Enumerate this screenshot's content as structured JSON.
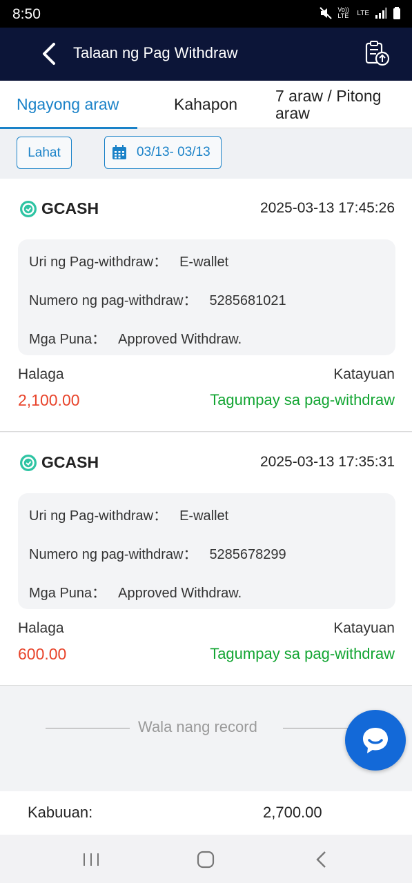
{
  "status_bar": {
    "time": "8:50",
    "icons": [
      "mute-icon",
      "volte-icon",
      "lte-icon",
      "signal-icon",
      "battery-icon"
    ],
    "volte_text": "Vo)) LTE",
    "lte_text": "LTE"
  },
  "header": {
    "title": "Talaan ng Pag Withdraw"
  },
  "tabs": [
    {
      "label": "Ngayong araw",
      "active": true
    },
    {
      "label": "Kahapon",
      "active": false
    },
    {
      "label": "7 araw / Pitong araw",
      "active": false
    }
  ],
  "filters": {
    "all_label": "Lahat",
    "date_range": "03/13- 03/13"
  },
  "records": [
    {
      "method": "GCASH",
      "datetime": "2025-03-13 17:45:26",
      "type_label": "Uri ng Pag-withdraw：",
      "type_value": "E-wallet",
      "number_label": "Numero ng pag-withdraw：",
      "number_value": "5285681021",
      "remarks_label": "Mga Puna：",
      "remarks_value": "Approved Withdraw.",
      "amount_label": "Halaga",
      "amount": "2,100.00",
      "status_label": "Katayuan",
      "status": "Tagumpay sa pag-withdraw"
    },
    {
      "method": "GCASH",
      "datetime": "2025-03-13 17:35:31",
      "type_label": "Uri ng Pag-withdraw：",
      "type_value": "E-wallet",
      "number_label": "Numero ng pag-withdraw：",
      "number_value": "5285678299",
      "remarks_label": "Mga Puna：",
      "remarks_value": "Approved Withdraw.",
      "amount_label": "Halaga",
      "amount": "600.00",
      "status_label": "Katayuan",
      "status": "Tagumpay sa pag-withdraw"
    }
  ],
  "no_more_text": "Wala nang record",
  "total": {
    "label": "Kabuuan:",
    "value": "2,700.00"
  },
  "colors": {
    "header_bg": "#0c1538",
    "accent": "#1a82c8",
    "amount": "#e8442b",
    "status_success": "#12a532",
    "chat_fab": "#1369d8"
  }
}
